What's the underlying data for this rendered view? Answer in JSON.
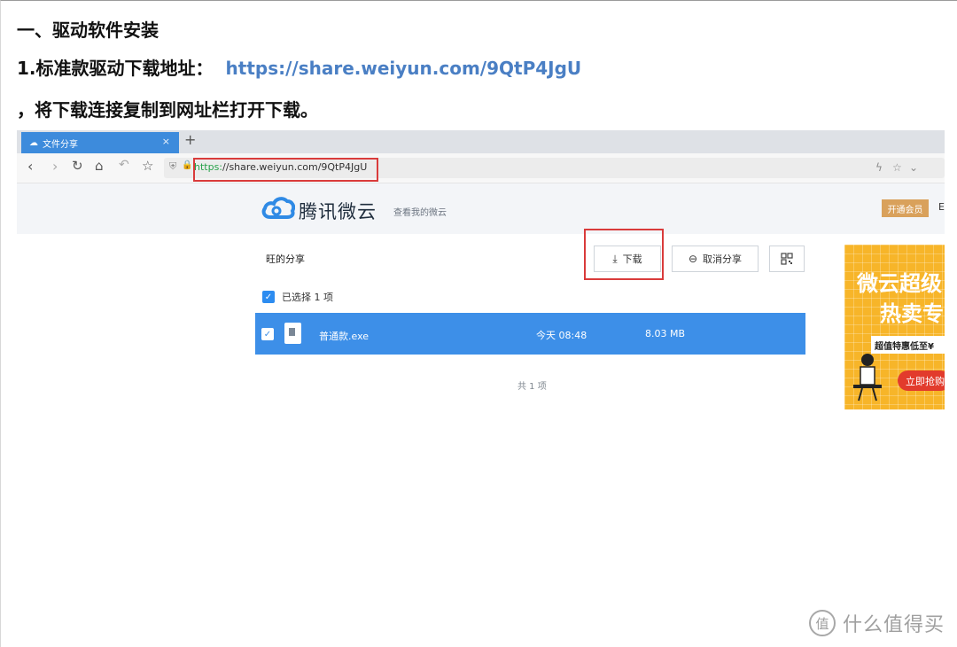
{
  "doc": {
    "heading": "一、驱动软件安装",
    "line2_prefix": "1.标准款驱动下载地址：",
    "line2_link": "https://share.weiyun.com/9QtP4JgU",
    "line3": "，将下载连接复制到网址栏打开下载。"
  },
  "browser": {
    "tab_title": "文件分享",
    "tab_close": "×",
    "new_tab": "+",
    "url_scheme": "https:",
    "url_rest": "//share.weiyun.com/9QtP4JgU",
    "icons": {
      "back": "chevron-left-icon",
      "forward": "chevron-right-icon",
      "reload": "reload-icon",
      "home": "home-icon",
      "undo": "undo-icon",
      "star": "star-icon",
      "shield": "shield-icon",
      "lock": "lock-icon"
    }
  },
  "site": {
    "logo_text": "腾讯微云",
    "my_weiyun": "查看我的微云",
    "vip_button": "开通会员",
    "cut_char": "E",
    "share_title": "旺的分享",
    "download_button": "下载",
    "cancel_share_button": "取消分享",
    "selected_text": "已选择 1 项",
    "file": {
      "name": "普通款.exe",
      "time": "今天 08:48",
      "size": "8.03 MB"
    },
    "total_count": "共 1 项"
  },
  "ad": {
    "line1": "微云超级",
    "line2": "热卖专",
    "strip": "超值特惠低至¥",
    "button": "立即抢购"
  },
  "watermark": {
    "logo_char": "值",
    "text": "什么值得买"
  },
  "colors": {
    "link": "#4a7fc4",
    "tab": "#3d8bdc",
    "highlight_box": "#d93b3b",
    "file_row": "#3d8fe8",
    "ad_bg": "#f7b529"
  }
}
